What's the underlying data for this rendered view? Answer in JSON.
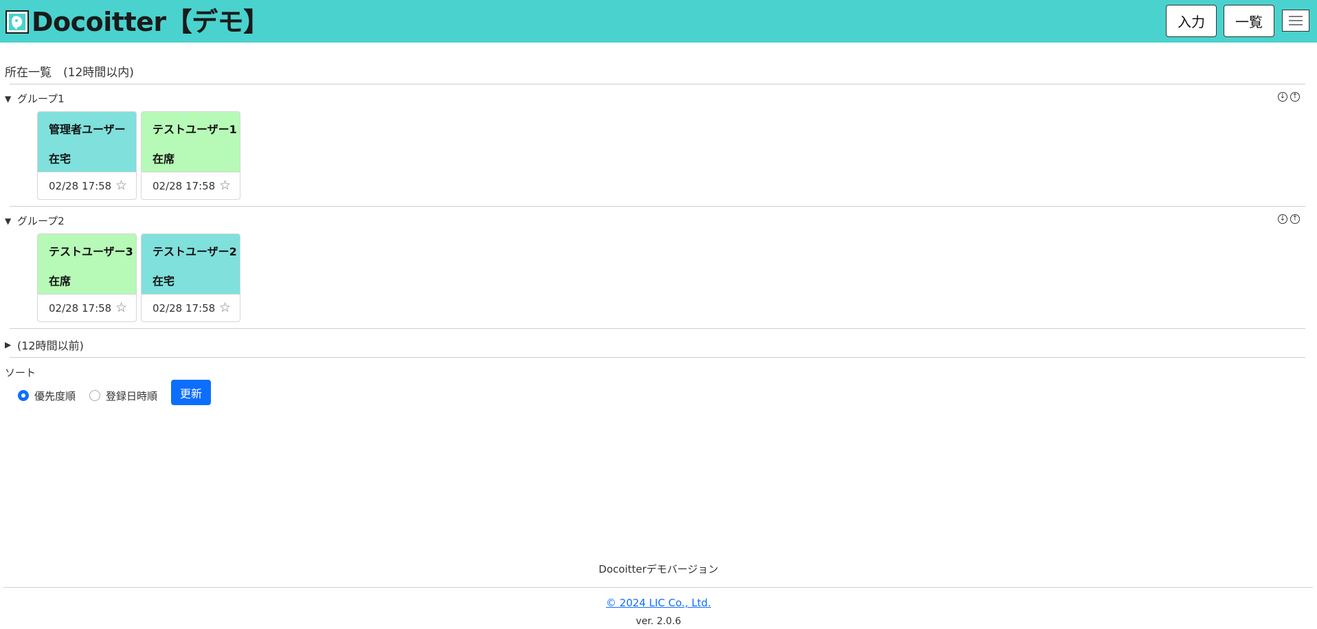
{
  "header": {
    "app_title": "Docoitter【デモ】",
    "input_button": "入力",
    "list_button": "一覧",
    "bg_color": "#4ad2ce"
  },
  "page": {
    "heading": "所在一覧　(12時間以内)"
  },
  "groups": [
    {
      "label": "グループ1",
      "cards": [
        {
          "name": "管理者ユーザー",
          "status": "在宅",
          "time": "02/28 17:58",
          "color": "#80e0dc"
        },
        {
          "name": "テストユーザー1",
          "status": "在席",
          "time": "02/28 17:58",
          "color": "#b7f9b7"
        }
      ]
    },
    {
      "label": "グループ2",
      "cards": [
        {
          "name": "テストユーザー3",
          "status": "在席",
          "time": "02/28 17:58",
          "color": "#b7f9b7"
        },
        {
          "name": "テストユーザー2",
          "status": "在宅",
          "time": "02/28 17:58",
          "color": "#80e0dc"
        }
      ]
    }
  ],
  "older": {
    "label": "(12時間以前)"
  },
  "sort": {
    "label": "ソート",
    "options": [
      "優先度順",
      "登録日時順"
    ],
    "selected": "優先度順",
    "update_button": "更新"
  },
  "footer": {
    "version_note": "Docoitterデモバージョン",
    "copyright": "© 2024 LIC Co., Ltd.",
    "version": "ver. 2.0.6"
  }
}
